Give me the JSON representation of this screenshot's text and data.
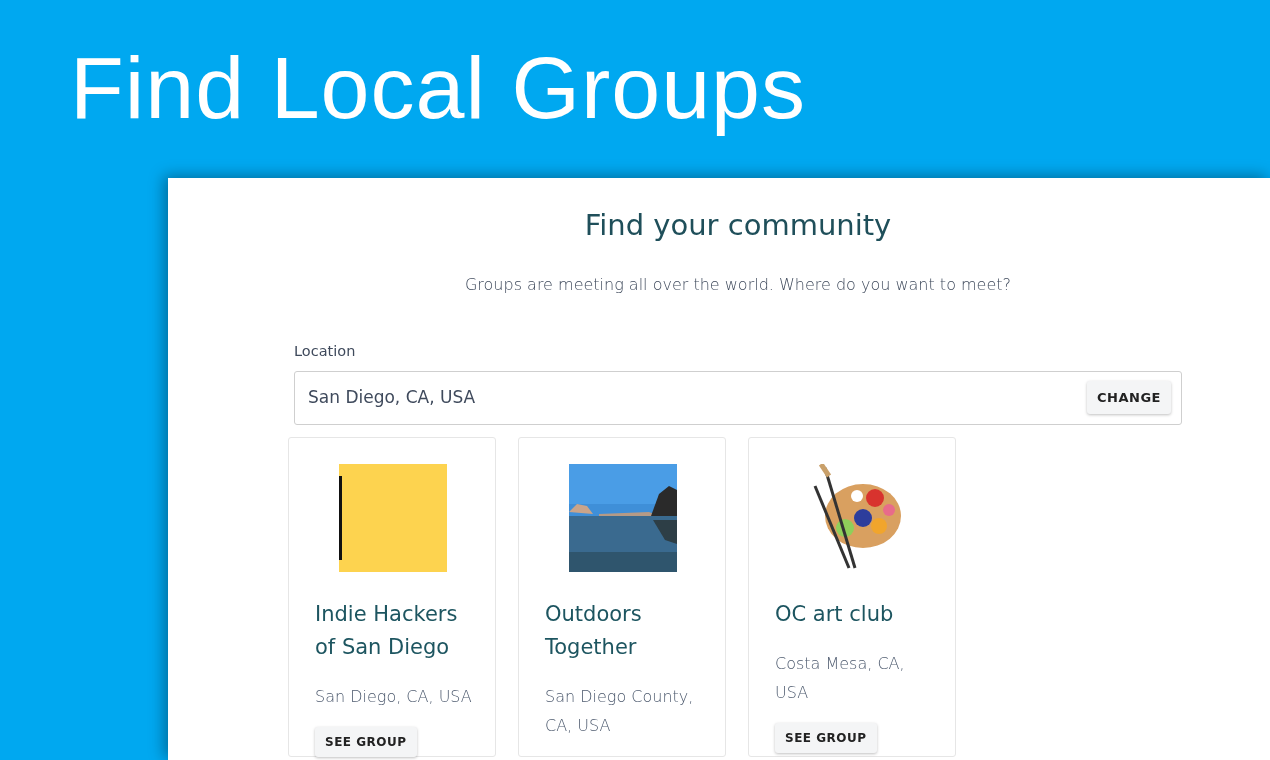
{
  "banner": {
    "title": "Find Local Groups"
  },
  "panel": {
    "heading": "Find your community",
    "subtitle": "Groups are meeting all over the world. Where do you want to meet?",
    "location": {
      "label": "Location",
      "value": "San Diego, CA, USA",
      "button": "CHANGE"
    }
  },
  "groups": [
    {
      "kind": "logo",
      "name": "Indie Hackers of San Diego",
      "location": "San Diego, CA, USA",
      "button": "SEE GROUP"
    },
    {
      "name": "Outdoors Together",
      "location": "San Diego County, CA, USA"
    },
    {
      "kind": "palette",
      "name": "OC art club",
      "location": "Costa Mesa, CA, USA",
      "button": "SEE GROUP"
    }
  ]
}
